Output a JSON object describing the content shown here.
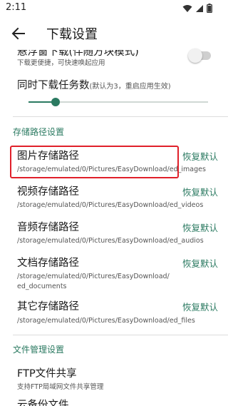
{
  "status_bar": {
    "time": "2:11"
  },
  "app_bar": {
    "title": "下载设置"
  },
  "floating_window": {
    "title": "悬浮窗下载(伴随方块模式)",
    "subtitle": "下载更便捷，可快速唤起应用",
    "enabled": false
  },
  "concurrent_tasks": {
    "title": "同时下载任务数",
    "hint": "(默认为3，重启应用生效)",
    "level_fraction": 0.15
  },
  "storage_section": {
    "header": "存储路径设置",
    "reset_label": "恢复默认",
    "items": [
      {
        "title": "图片存储路径",
        "path": "/storage/emulated/0/Pictures/EasyDownload/ed_images"
      },
      {
        "title": "视频存储路径",
        "path": "/storage/emulated/0/Pictures/EasyDownload/ed_videos"
      },
      {
        "title": "音频存储路径",
        "path": "/storage/emulated/0/Pictures/EasyDownload/ed_audios"
      },
      {
        "title": "文档存储路径",
        "path": "/storage/emulated/0/Pictures/EasyDownload/\ned_documents"
      },
      {
        "title": "其它存储路径",
        "path": "/storage/emulated/0/Pictures/EasyDownload/ed_files"
      }
    ]
  },
  "file_section": {
    "header": "文件管理设置",
    "ftp": {
      "title": "FTP文件共享",
      "subtitle": "支持FTP局域网文件共享管理"
    },
    "next_item_title": "云备份文件"
  },
  "colors": {
    "accent": "#2b7a61",
    "highlight": "#e0202a"
  }
}
